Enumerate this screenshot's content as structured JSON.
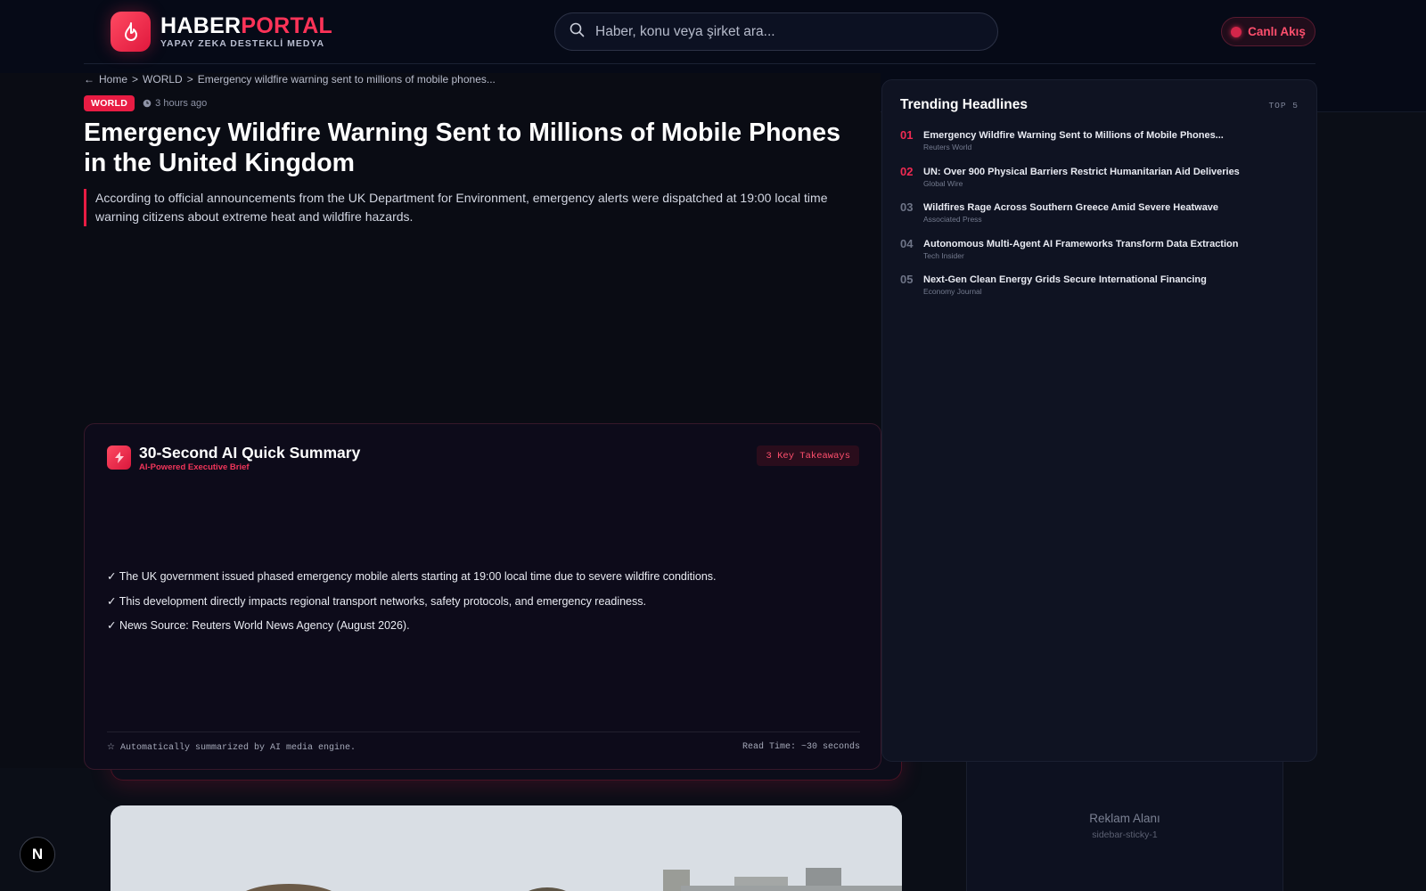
{
  "brand": {
    "name_white": "HABER",
    "name_red": "PORTAL",
    "tagline": "YAPAY ZEKA DESTEKLİ MEDYA"
  },
  "search": {
    "placeholder": "Haber, konu veya şirket ara..."
  },
  "live": {
    "label": "Canlı Akış"
  },
  "breadcrumb": {
    "back": "←",
    "home": "Home",
    "sep": ">",
    "category": "WORLD",
    "current": "Emergency wildfire warning sent to millions of mobile phones..."
  },
  "article": {
    "category": "WORLD",
    "time": "3 hours ago",
    "title": "Emergency Wildfire Warning Sent to Millions of Mobile Phones in the United Kingdom",
    "lead": "According to official announcements from the UK Department for Environment, emergency alerts were dispatched at 19:00 local time warning citizens about extreme heat and wildfire hazards."
  },
  "summary": {
    "title": "30-Second AI Quick Summary",
    "subtitle": "AI-Powered Executive Brief",
    "chip": "3 Key Takeaways",
    "bullets": [
      "✓ The UK government issued phased emergency mobile alerts starting at 19:00 local time due to severe wildfire conditions.",
      "✓ This development directly impacts regional transport networks, safety protocols, and emergency readiness.",
      "✓ News Source: Reuters World News Agency (August 2026)."
    ],
    "footer_left": "☆ Automatically summarized by AI media engine.",
    "footer_right": "Read Time: ~30 seconds"
  },
  "trending": {
    "title": "Trending Headlines",
    "badge": "TOP 5",
    "items": [
      {
        "num": "01",
        "headline": "Emergency Wildfire Warning Sent to Millions of Mobile Phones...",
        "source": "Reuters World"
      },
      {
        "num": "02",
        "headline": "UN: Over 900 Physical Barriers Restrict Humanitarian Aid Deliveries",
        "source": "Global Wire"
      },
      {
        "num": "03",
        "headline": "Wildfires Rage Across Southern Greece Amid Severe Heatwave",
        "source": "Associated Press"
      },
      {
        "num": "04",
        "headline": "Autonomous Multi-Agent AI Frameworks Transform Data Extraction",
        "source": "Tech Insider"
      },
      {
        "num": "05",
        "headline": "Next-Gen Clean Energy Grids Secure International Financing",
        "source": "Economy Journal"
      }
    ]
  },
  "ad": {
    "label": "Reklam Alanı",
    "slot": "sidebar-sticky-1"
  },
  "dev_badge": {
    "letter": "N"
  },
  "colors": {
    "accent": "#e81c43",
    "background": "#0b0e17",
    "card": "#0f1322"
  }
}
